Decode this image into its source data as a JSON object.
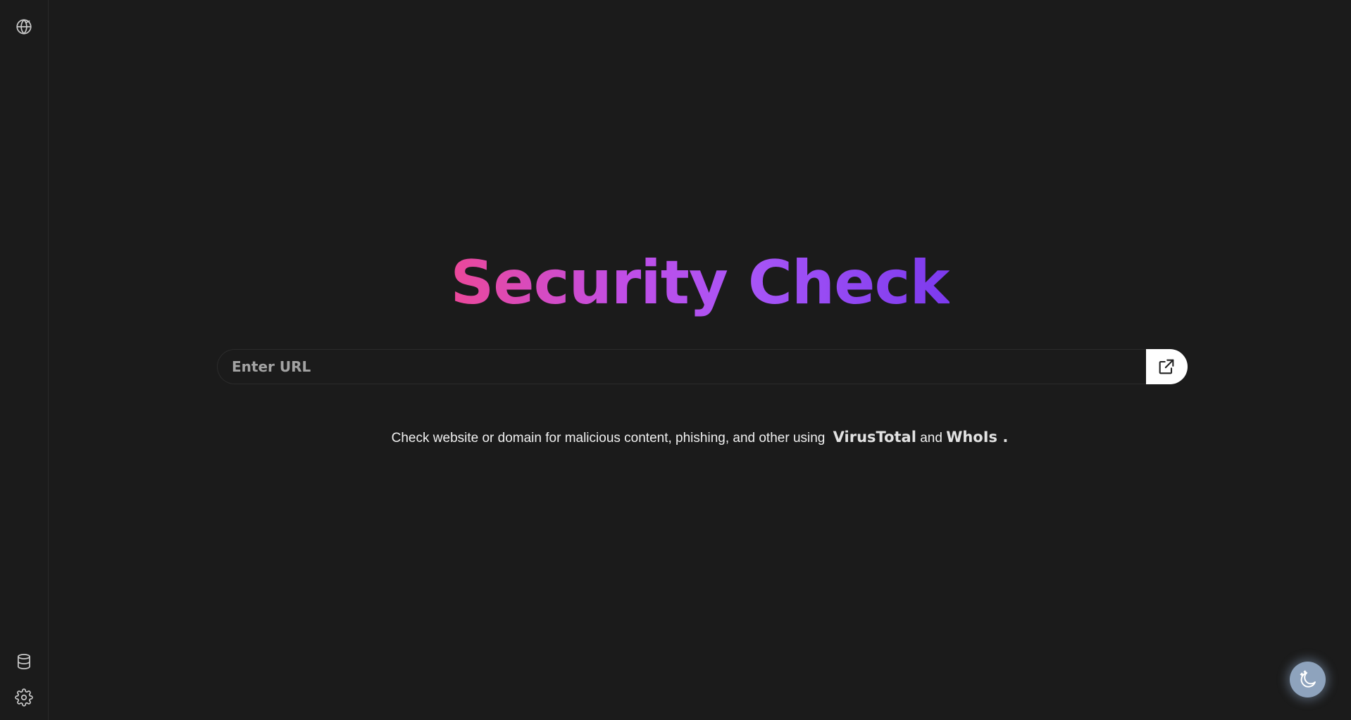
{
  "sidebar": {
    "top_icon": "globe-icon",
    "bottom_icons": [
      "database-icon",
      "gear-icon"
    ]
  },
  "main": {
    "title": "Security Check",
    "search": {
      "placeholder": "Enter URL",
      "value": "",
      "button_icon": "external-link-icon"
    },
    "description": {
      "prefix": "Check website or domain for malicious content, phishing, and other using",
      "service_1": "VirusTotal",
      "joiner": "and",
      "service_2": "WhoIs .",
      "service_1_color": "#e2e2e2",
      "service_2_color": "#e2e2e2"
    },
    "title_gradient": [
      "#ec4899",
      "#a855f7",
      "#7c3aed"
    ]
  },
  "theme_toggle": {
    "icon": "moon-stars-icon",
    "color": "#8ea3bd"
  }
}
